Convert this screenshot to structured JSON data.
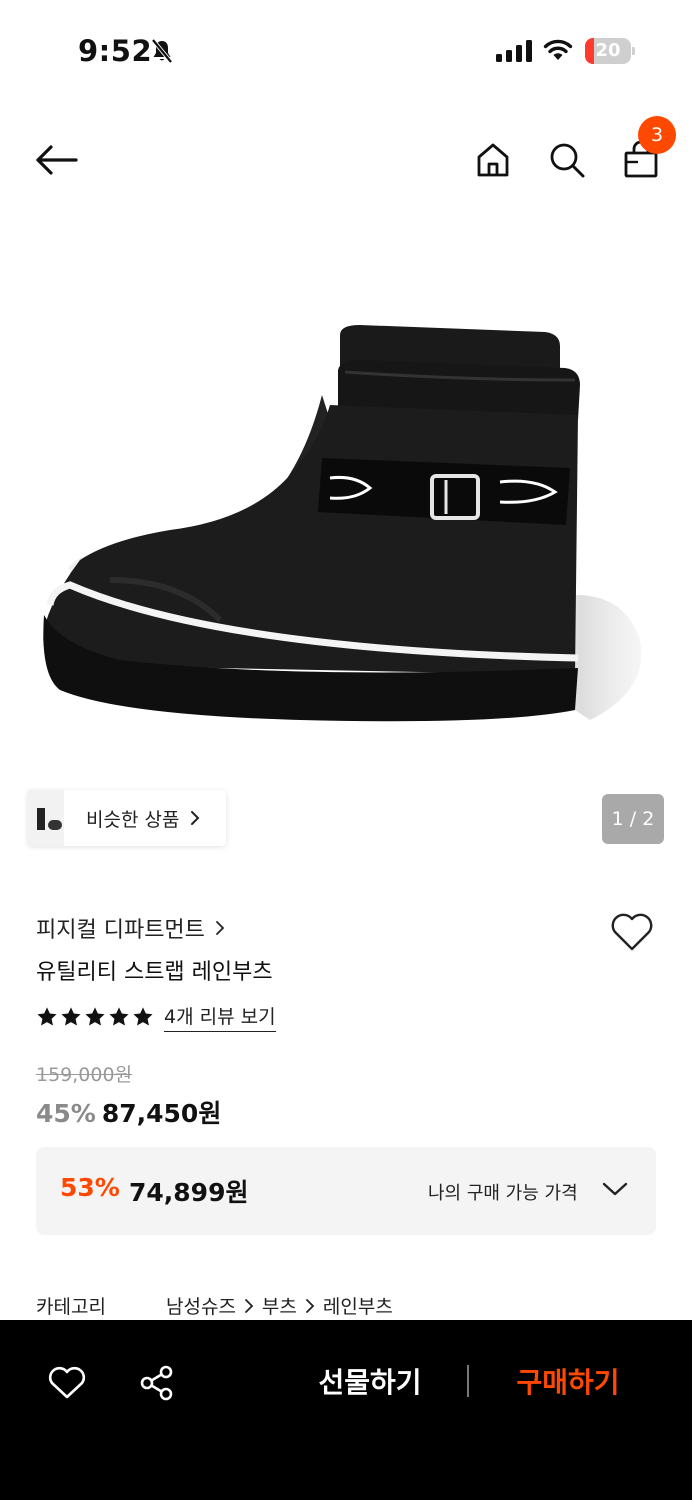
{
  "status_bar": {
    "time": "9:52",
    "battery_level": "20",
    "battery_fraction": 0.2
  },
  "nav": {
    "cart_count": "3",
    "icons": [
      "back-arrow-icon",
      "home-icon",
      "search-icon",
      "shopping-bag-icon"
    ]
  },
  "gallery": {
    "similar_label": "비슷한 상품",
    "page_indicator": "1 / 2"
  },
  "product": {
    "brand": "피지컬 디파트먼트",
    "name": "유틸리티 스트랩 레인부츠",
    "rating_stars": 5,
    "review_link": "4개 리뷰 보기",
    "original_price": "159,000원",
    "discount_rate": "45%",
    "sale_price": "87,450원"
  },
  "my_price": {
    "rate": "53%",
    "price": "74,899원",
    "label": "나의 구매 가능 가격"
  },
  "category": {
    "label": "카테고리",
    "path": [
      "남성슈즈",
      "부츠",
      "레인부츠"
    ]
  },
  "bottom_bar": {
    "gift_label": "선물하기",
    "buy_label": "구매하기"
  },
  "colors": {
    "accent": "#ff4800",
    "bottom_bar_bg": "#000000",
    "price_box_bg": "#f4f4f4"
  }
}
